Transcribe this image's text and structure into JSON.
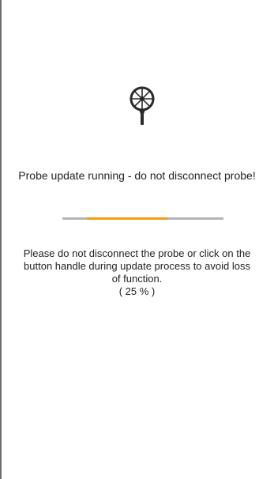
{
  "screen": {
    "status_title": "Probe update running - do not disconnect probe!",
    "message_lines": [
      "Please do not disconnect the probe or click on the",
      "button handle during update process to avoid loss",
      "of function."
    ],
    "percent_label": "( 25 % )",
    "progress_percent": 25
  },
  "icons": {
    "probe": "vane-anemometer-probe-icon"
  },
  "colors": {
    "progress_fill": "#f39c12",
    "progress_track": "#b4b4b4"
  }
}
